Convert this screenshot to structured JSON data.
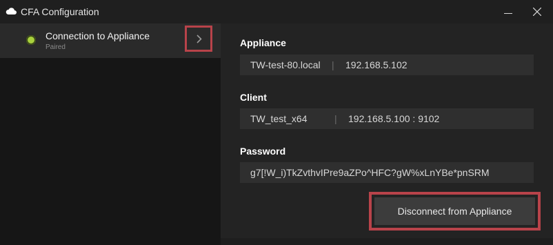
{
  "window": {
    "title": "CFA Configuration",
    "minimize_icon": "minimize-icon",
    "close_icon": "close-icon"
  },
  "sidebar": {
    "items": [
      {
        "title": "Connection to Appliance",
        "subtitle": "Paired",
        "status_color": "#a9d13d",
        "action_icon": "chevron-right-icon"
      }
    ]
  },
  "appliance": {
    "label": "Appliance",
    "hostname": "TW-test-80.local",
    "ip": "192.168.5.102"
  },
  "client": {
    "label": "Client",
    "hostname": "TW_test_x64",
    "address": "192.168.5.100 : 9102"
  },
  "password": {
    "label": "Password",
    "value": "g7[!W_i)TkZvthvIPre9aZPo^HFC?gW%xLnYBe*pnSRM"
  },
  "actions": {
    "disconnect_label": "Disconnect from Appliance"
  },
  "colors": {
    "accent_highlight": "#b8434a",
    "status_ok": "#a9d13d"
  }
}
